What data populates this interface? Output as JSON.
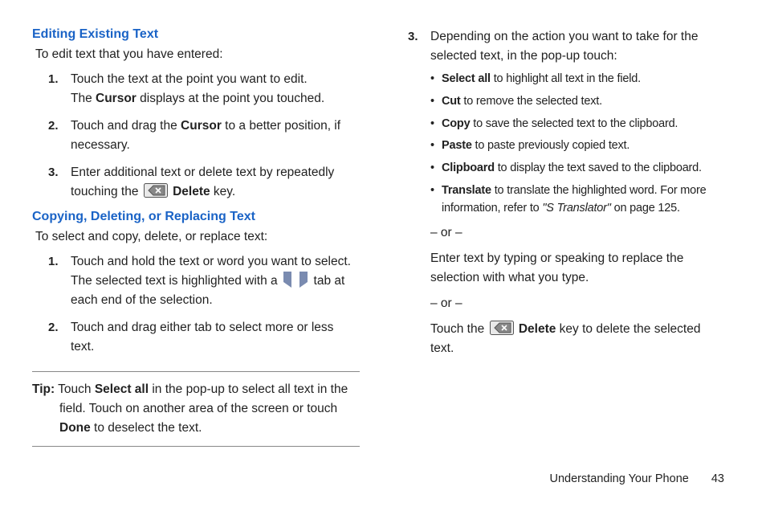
{
  "left": {
    "section1_title": "Editing Existing Text",
    "section1_intro": "To edit text that you have entered:",
    "s1_step1a": "Touch the text at the point you want to edit.",
    "s1_step1b_pre": "The ",
    "s1_step1b_bold": "Cursor",
    "s1_step1b_post": " displays at the point you touched.",
    "s1_step2_pre": "Touch and drag the ",
    "s1_step2_bold": "Cursor",
    "s1_step2_post": " to a better position, if necessary.",
    "s1_step3_pre": "Enter additional text or delete text by repeatedly touching the ",
    "s1_step3_bold": " Delete",
    "s1_step3_post": " key.",
    "section2_title": "Copying, Deleting, or Replacing Text",
    "section2_intro": "To select and copy, delete, or replace text:",
    "s2_step1a": "Touch and hold the text or word you want to select.",
    "s2_step1b_pre": "The selected text is highlighted with a ",
    "s2_step1b_post": " tab at each end of the selection.",
    "s2_step2": "Touch and drag either tab to select more or less text.",
    "tip_label": "Tip:",
    "tip_pre": " Touch ",
    "tip_bold1": "Select all",
    "tip_mid": " in the pop-up to select all text in the field. Touch on another area of the screen or touch ",
    "tip_bold2": "Done",
    "tip_post": " to deselect the text."
  },
  "right": {
    "step3_n": "3.",
    "step3_intro": "Depending on the action you want to take for the selected text, in the pop-up touch:",
    "opts": [
      {
        "b": "Select all",
        "t": " to highlight all text in the field."
      },
      {
        "b": "Cut",
        "t": " to remove the selected text."
      },
      {
        "b": "Copy",
        "t": " to save the selected text to the clipboard."
      },
      {
        "b": "Paste",
        "t": " to paste previously copied text."
      },
      {
        "b": "Clipboard",
        "t": " to display the text saved to the clipboard."
      },
      {
        "b": "Translate",
        "t": " to translate the highlighted word. For more information, refer to ",
        "it": "\"S Translator\"",
        "t2": " on page 125."
      }
    ],
    "or": "– or –",
    "para1": "Enter text by typing or speaking to replace the selection with what you type.",
    "final_pre": "Touch the ",
    "final_bold": " Delete",
    "final_post": " key to delete the selected text."
  },
  "footer": {
    "title": "Understanding Your Phone",
    "page": "43"
  },
  "numbers": {
    "n1": "1.",
    "n2": "2.",
    "n3": "3."
  }
}
